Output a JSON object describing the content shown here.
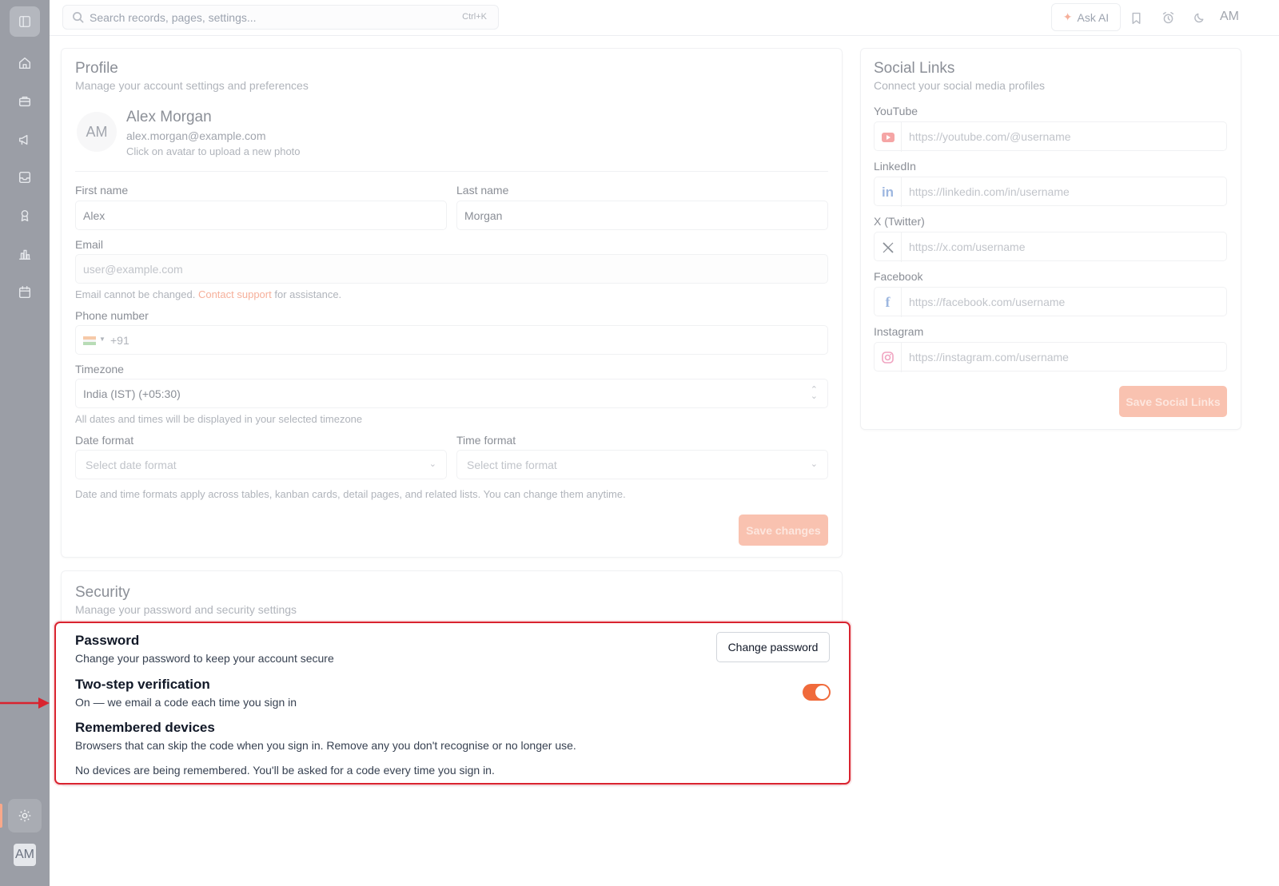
{
  "topbar": {
    "search_placeholder": "Search records, pages, settings...",
    "search_shortcut": "Ctrl+K",
    "ask_ai_label": "Ask AI",
    "avatar_initials": "AM"
  },
  "sidebar": {
    "avatar_initials": "AM",
    "icons": [
      "sidebar-toggle-icon",
      "home-icon",
      "briefcase-icon",
      "megaphone-icon",
      "inbox-icon",
      "award-icon",
      "chart-icon",
      "calendar-icon",
      "settings-icon"
    ]
  },
  "profile": {
    "title": "Profile",
    "subtitle": "Manage your account settings and preferences",
    "avatar_initials": "AM",
    "name": "Alex Morgan",
    "email": "alex.morgan@example.com",
    "avatar_hint": "Click on avatar to upload a new photo",
    "first_name_label": "First name",
    "first_name_value": "Alex",
    "last_name_label": "Last name",
    "last_name_value": "Morgan",
    "email_label": "Email",
    "email_placeholder": "user@example.com",
    "email_help_pre": "Email cannot be changed.",
    "email_help_link": "Contact support",
    "email_help_post": "for assistance.",
    "phone_label": "Phone number",
    "phone_prefix": "+91",
    "timezone_label": "Timezone",
    "timezone_value": "India (IST) (+05:30)",
    "timezone_help": "All dates and times will be displayed in your selected timezone",
    "date_format_label": "Date format",
    "date_format_placeholder": "Select date format",
    "time_format_label": "Time format",
    "time_format_placeholder": "Select time format",
    "format_help": "Date and time formats apply across tables, kanban cards, detail pages, and related lists. You can change them anytime.",
    "save_label": "Save changes"
  },
  "security": {
    "title": "Security",
    "subtitle": "Manage your password and security settings",
    "password_title": "Password",
    "password_desc": "Change your password to keep your account secure",
    "change_password_label": "Change password",
    "two_step_title": "Two-step verification",
    "two_step_desc": "On — we email a code each time you sign in",
    "two_step_enabled": true,
    "remembered_title": "Remembered devices",
    "remembered_desc": "Browsers that can skip the code when you sign in. Remove any you don't recognise or no longer use.",
    "remembered_empty": "No devices are being remembered. You'll be asked for a code every time you sign in."
  },
  "social": {
    "title": "Social Links",
    "subtitle": "Connect your social media profiles",
    "links": [
      {
        "label": "YouTube",
        "placeholder": "https://youtube.com/@username",
        "icon": "youtube-icon"
      },
      {
        "label": "LinkedIn",
        "placeholder": "https://linkedin.com/in/username",
        "icon": "linkedin-icon"
      },
      {
        "label": "X (Twitter)",
        "placeholder": "https://x.com/username",
        "icon": "x-icon"
      },
      {
        "label": "Facebook",
        "placeholder": "https://facebook.com/username",
        "icon": "facebook-icon"
      },
      {
        "label": "Instagram",
        "placeholder": "https://instagram.com/username",
        "icon": "instagram-icon"
      }
    ],
    "save_label": "Save Social Links"
  },
  "colors": {
    "accent": "#f06a3b",
    "highlight": "#d9232f",
    "sidebar": "#9b9ea6"
  }
}
